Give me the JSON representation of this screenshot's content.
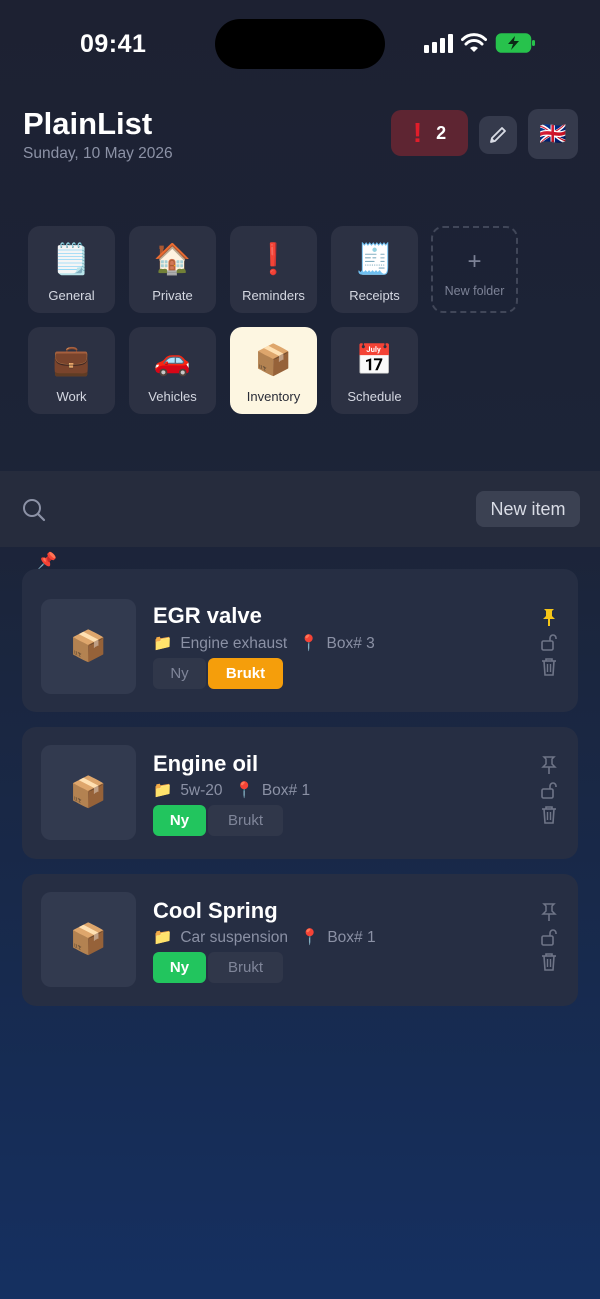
{
  "status_bar": {
    "time": "09:41"
  },
  "header": {
    "title": "PlainList",
    "date": "Sunday, 10 May 2026",
    "alert_icon": "!",
    "alert_count": "2",
    "language_flag": "🇬🇧"
  },
  "folders": [
    {
      "label": "General",
      "icon": "🗒️"
    },
    {
      "label": "Private",
      "icon": "🏠"
    },
    {
      "label": "Reminders",
      "icon": "❗"
    },
    {
      "label": "Receipts",
      "icon": "🧾"
    },
    {
      "label": "Work",
      "icon": "💼"
    },
    {
      "label": "Vehicles",
      "icon": "🚗"
    },
    {
      "label": "Inventory",
      "icon": "📦",
      "active": true
    },
    {
      "label": "Schedule",
      "icon": "📅"
    }
  ],
  "new_folder": {
    "plus": "+",
    "label": "New folder"
  },
  "search": {
    "placeholder": "",
    "value": ""
  },
  "new_item_label": "New item",
  "pin_marker": "📌",
  "items": [
    {
      "name": "EGR valve",
      "thumb": "📦",
      "folder_icon": "📁",
      "folder": "Engine exhaust",
      "loc_icon": "📍",
      "location": "Box# 3",
      "tag_new": "Ny",
      "tag_used": "Brukt",
      "state": "used",
      "pinned": true
    },
    {
      "name": "Engine oil",
      "thumb": "📦",
      "folder_icon": "📁",
      "folder": "5w-20",
      "loc_icon": "📍",
      "location": "Box# 1",
      "tag_new": "Ny",
      "tag_used": "Brukt",
      "state": "new",
      "pinned": false
    },
    {
      "name": "Cool Spring",
      "thumb": "📦",
      "folder_icon": "📁",
      "folder": "Car suspension",
      "loc_icon": "📍",
      "location": "Box# 1",
      "tag_new": "Ny",
      "tag_used": "Brukt",
      "state": "new",
      "pinned": false
    }
  ],
  "colors": {
    "accent_new": "#22c55e",
    "accent_used": "#f59e0b",
    "pin_active": "#f5c518",
    "alert": "#e11d2a"
  }
}
